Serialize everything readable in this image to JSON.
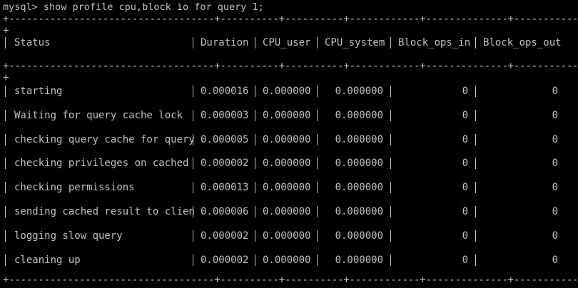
{
  "terminal": {
    "command": "mysql> show profile cpu,block io for query 1;",
    "separator": "+-----------------------------------+----------+----------+------------+--------------+---------------+",
    "plus": "+",
    "headers": [
      "Status",
      "Duration",
      "CPU_user",
      "CPU_system",
      "Block_ops_in",
      "Block_ops_out"
    ],
    "rows": [
      {
        "status": "starting",
        "duration": "0.000016",
        "cpu_user": "0.000000",
        "cpu_system": "0.000000",
        "block_in": "0",
        "block_out": "0"
      },
      {
        "status": "Waiting for query cache lock",
        "duration": "0.000003",
        "cpu_user": "0.000000",
        "cpu_system": "0.000000",
        "block_in": "0",
        "block_out": "0"
      },
      {
        "status": "checking query cache for query",
        "duration": "0.000005",
        "cpu_user": "0.000000",
        "cpu_system": "0.000000",
        "block_in": "0",
        "block_out": "0"
      },
      {
        "status": "checking privileges on cached",
        "duration": "0.000002",
        "cpu_user": "0.000000",
        "cpu_system": "0.000000",
        "block_in": "0",
        "block_out": "0"
      },
      {
        "status": "checking permissions",
        "duration": "0.000013",
        "cpu_user": "0.000000",
        "cpu_system": "0.000000",
        "block_in": "0",
        "block_out": "0"
      },
      {
        "status": "sending cached result to clien",
        "duration": "0.000006",
        "cpu_user": "0.000000",
        "cpu_system": "0.000000",
        "block_in": "0",
        "block_out": "0"
      },
      {
        "status": "logging slow query",
        "duration": "0.000002",
        "cpu_user": "0.000000",
        "cpu_system": "0.000000",
        "block_in": "0",
        "block_out": "0"
      },
      {
        "status": "cleaning up",
        "duration": "0.000002",
        "cpu_user": "0.000000",
        "cpu_system": "0.000000",
        "block_in": "0",
        "block_out": "0"
      }
    ]
  },
  "colors": {
    "background": "#000000",
    "foreground": "#c0c0c0"
  }
}
